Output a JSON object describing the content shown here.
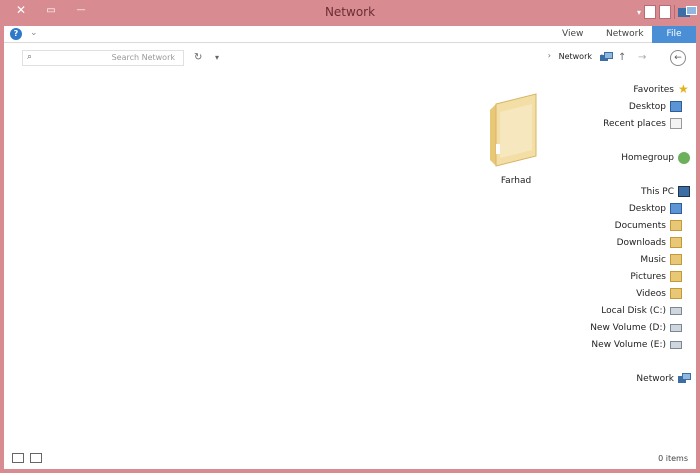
{
  "window": {
    "title": "Network"
  },
  "title_buttons": {
    "close": "✕",
    "maximize": "▭",
    "minimize": "—"
  },
  "ribbon": {
    "file_tab": "File",
    "tabs": [
      "Network",
      "View"
    ],
    "help_label": "?"
  },
  "address_bar": {
    "breadcrumb": "Network",
    "search_placeholder": "Search Network"
  },
  "nav_pane": {
    "favorites": {
      "label": "Favorites",
      "items": [
        "Desktop",
        "Recent places"
      ]
    },
    "homegroup": "Homegroup",
    "this_pc": {
      "label": "This PC",
      "items": [
        "Desktop",
        "Documents",
        "Downloads",
        "Music",
        "Pictures",
        "Videos",
        "Local Disk (C:)",
        "New Volume (D:)",
        "New Volume (E:)"
      ]
    },
    "network": "Network"
  },
  "content": {
    "items": [
      {
        "name": "Farhad",
        "icon": "folder-icon"
      }
    ]
  },
  "status_bar": {
    "count": "0 items"
  },
  "colors": {
    "frame": "#d88c92",
    "accent": "#4a8fd6",
    "folder": "#f1d9a4"
  }
}
